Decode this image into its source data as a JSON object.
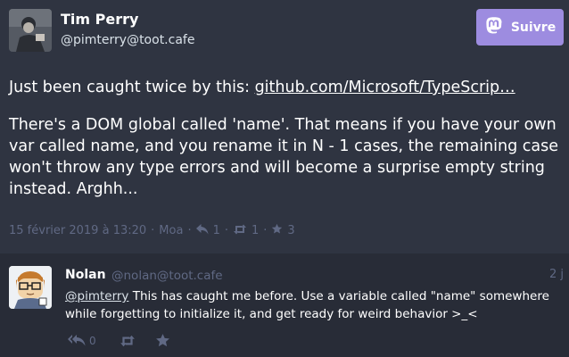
{
  "main": {
    "author_name": "Tim Perry",
    "author_handle": "@pimterry@toot.cafe",
    "follow_label": "Suivre",
    "text_intro": "Just been caught twice by this: ",
    "link_text": "github.com/Microsoft/TypeScrip…",
    "paragraph2": "There's a DOM global called 'name'. That means if you have your own var called name, and you rename it in N - 1 cases, the remaining case won't throw any type errors and will become a surprise empty string instead. Arghh...",
    "timestamp": "15 février 2019 à 13:20",
    "separator": "·",
    "app_name": "Moa",
    "reply_count": "1",
    "boost_count": "1",
    "favourite_count": "3"
  },
  "reply": {
    "author_name": "Nolan",
    "author_handle": "@nolan@toot.cafe",
    "relative_time": "2 j",
    "mention": "@pimterry",
    "text": " This has caught me before. Use a variable called \"name\" somewhere while forgetting to initialize it, and get ready for weird behavior >_<",
    "reply_count": "0"
  },
  "icons": {
    "follow": "mastodon-icon",
    "reply": "reply-icon",
    "reply_all": "reply-all-icon",
    "boost": "retweet-icon",
    "favourite": "star-icon"
  },
  "colors": {
    "accent": "#9d8ce0",
    "background": "#282c37",
    "main_status_bg": "#2f3441",
    "muted_text": "#606984"
  }
}
